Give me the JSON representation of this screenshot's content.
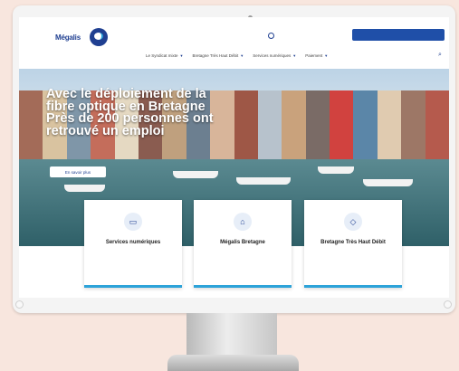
{
  "header": {
    "logo_text": "Mégalis",
    "logo_sub": "",
    "top_link": "",
    "top_button": "",
    "search_icon": "search-icon"
  },
  "nav": [
    {
      "label": "Le Syndicat mixte"
    },
    {
      "label": "Bretagne Très Haut Débit"
    },
    {
      "label": "Services numériques"
    },
    {
      "label": "Paiement"
    }
  ],
  "hero": {
    "title": "Avec le déploiement de la fibre optique en Bretagne Près de 200 personnes ont retrouvé un emploi",
    "button": "En savoir plus"
  },
  "cards": [
    {
      "icon": "laptop-icon",
      "title": "Services numériques",
      "desc": ""
    },
    {
      "icon": "building-icon",
      "title": "Mégalis Bretagne",
      "desc": ""
    },
    {
      "icon": "wifi-icon",
      "title": "Bretagne Très Haut Débit",
      "desc": ""
    }
  ],
  "colors": {
    "brand": "#1f3f91",
    "accent": "#2da3d9",
    "background": "#f8e6de"
  }
}
